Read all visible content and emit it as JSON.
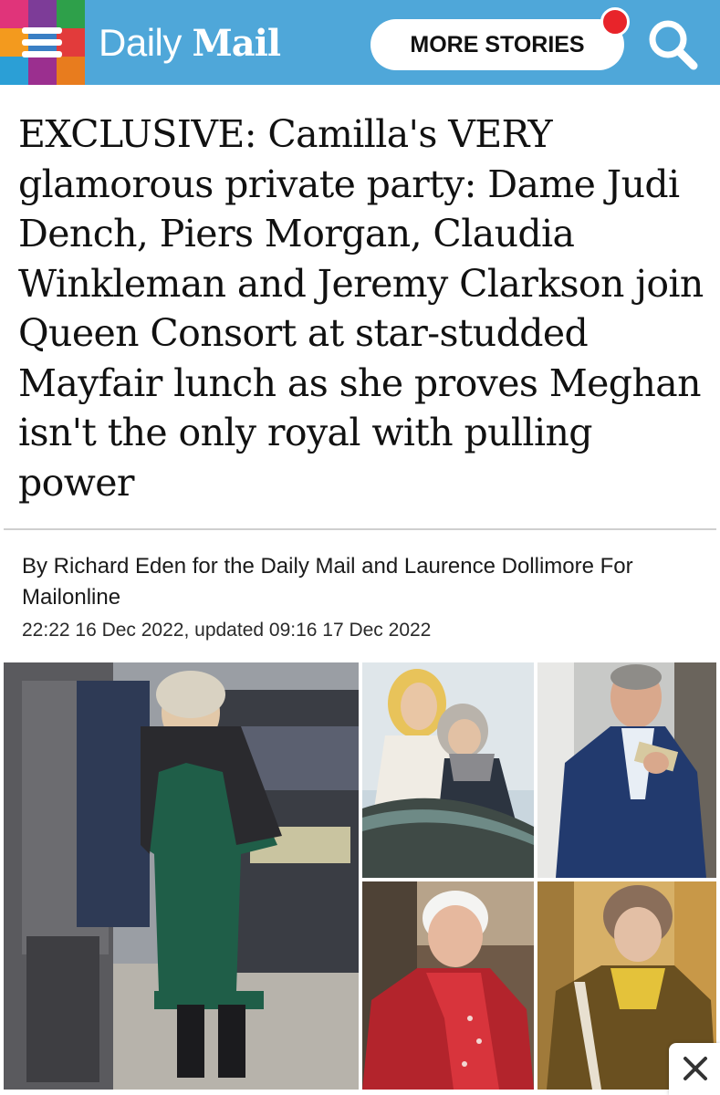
{
  "header": {
    "menu_icon": "hamburger-menu-icon",
    "brand_daily": "Daily",
    "brand_mail": "Mail",
    "more_stories_label": "MORE STORIES",
    "search_icon": "search-icon",
    "accent_color": "#4fa7d9",
    "notification_color": "#e8242a"
  },
  "article": {
    "headline": "EXCLUSIVE: Camilla's VERY glamorous private party: Dame Judi Dench, Piers Morgan, Claudia Winkleman and Jeremy Clarkson join Queen Consort at star-studded Mayfair lunch as she proves Meghan isn't the only royal with pulling power",
    "byline": "By Richard Eden for the Daily Mail and Laurence Dollimore For Mailonline",
    "dateline": "22:22 16 Dec 2022, updated 09:16 17 Dec 2022"
  },
  "close_icon": "close-icon"
}
